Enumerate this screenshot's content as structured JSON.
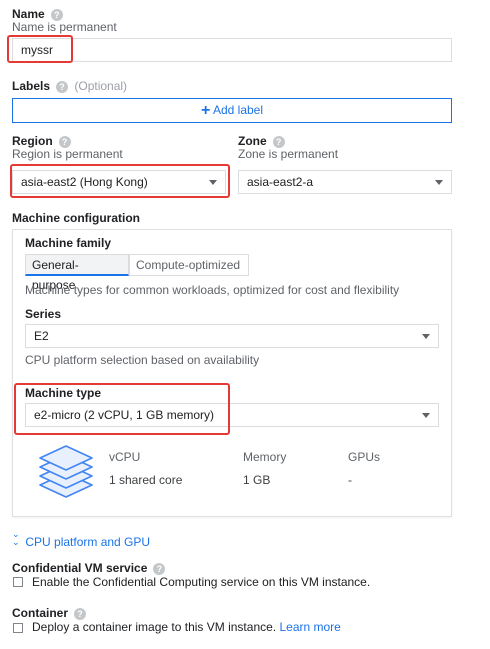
{
  "name": {
    "label": "Name",
    "hint": "Name is permanent",
    "value": "myssr"
  },
  "labels": {
    "label": "Labels",
    "optional": "(Optional)",
    "add_button": "Add label"
  },
  "region": {
    "label": "Region",
    "hint": "Region is permanent",
    "value": "asia-east2 (Hong Kong)"
  },
  "zone": {
    "label": "Zone",
    "hint": "Zone is permanent",
    "value": "asia-east2-a"
  },
  "machine_config": {
    "title": "Machine configuration",
    "family_label": "Machine family",
    "tabs": [
      "General-purpose",
      "Compute-optimized"
    ],
    "family_description": "Machine types for common workloads, optimized for cost and flexibility",
    "series_label": "Series",
    "series_value": "E2",
    "series_hint": "CPU platform selection based on availability",
    "type_label": "Machine type",
    "type_value": "e2-micro (2 vCPU, 1 GB memory)",
    "specs": {
      "headers": [
        "vCPU",
        "Memory",
        "GPUs"
      ],
      "values": [
        "1 shared core",
        "1 GB",
        "-"
      ]
    }
  },
  "cpu_platform_link": "CPU platform and GPU",
  "confidential": {
    "label": "Confidential VM service",
    "checkbox": "Enable the Confidential Computing service on this VM instance."
  },
  "container": {
    "label": "Container",
    "checkbox": "Deploy a container image to this VM instance.",
    "link": "Learn more"
  },
  "colors": {
    "accent": "#1a73e8",
    "highlight": "#e53935",
    "stack_icon": "#4285f4"
  }
}
